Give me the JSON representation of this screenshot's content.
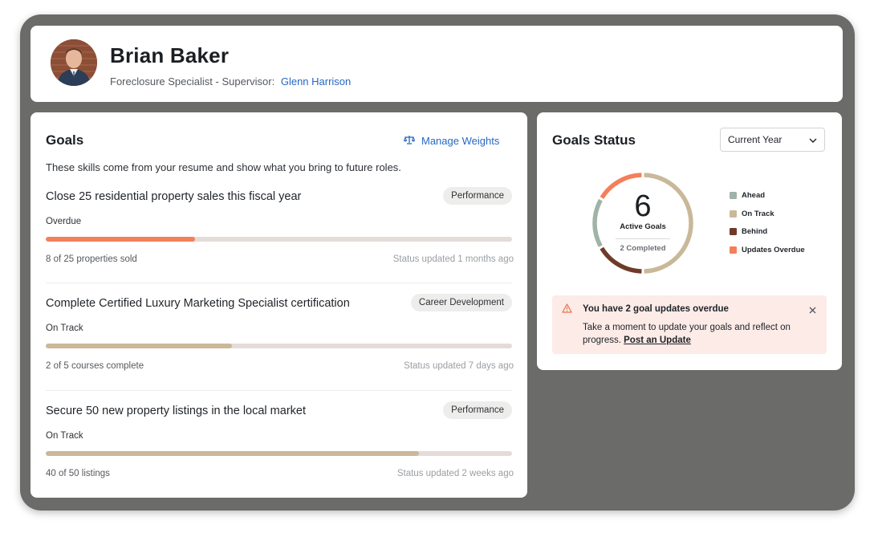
{
  "profile": {
    "name": "Brian Baker",
    "role": "Foreclosure Specialist",
    "supervisor_prefix": "- Supervisor:",
    "supervisor_name": "Glenn Harrison",
    "avatar_icon": "person-photo"
  },
  "goals": {
    "title": "Goals",
    "manage_label": "Manage Weights",
    "manage_icon": "scale-icon",
    "description": "These skills come from your resume and show what you bring to future roles.",
    "items": [
      {
        "title": "Close 25 residential property sales this fiscal year",
        "tag": "Performance",
        "status": "Overdue",
        "progress_text": "8 of 25 properties sold",
        "progress": 0.32,
        "bar_color": "#f47f5b",
        "updated": "Status updated 1 months ago"
      },
      {
        "title": "Complete Certified Luxury Marketing Specialist certification",
        "tag": "Career Development",
        "status": "On Track",
        "progress_text": "2 of 5 courses complete",
        "progress": 0.4,
        "bar_color": "#c9b899",
        "updated": "Status updated 7 days ago"
      },
      {
        "title": "Secure 50 new property listings in the local market",
        "tag": "Performance",
        "status": "On Track",
        "progress_text": "40 of 50 listings",
        "progress": 0.8,
        "bar_color": "#c9b899",
        "updated": "Status updated 2 weeks ago"
      }
    ]
  },
  "status": {
    "title": "Goals Status",
    "period": "Current Year",
    "active_count": "6",
    "active_label": "Active Goals",
    "completed_label": "2 Completed",
    "segments": [
      {
        "name": "On Track",
        "fraction": 0.5,
        "color": "#c9b899"
      },
      {
        "name": "Behind",
        "fraction": 0.167,
        "color": "#6e3b2a"
      },
      {
        "name": "Ahead",
        "fraction": 0.167,
        "color": "#9fb3a8"
      },
      {
        "name": "Updates Overdue",
        "fraction": 0.166,
        "color": "#f47f5b"
      }
    ],
    "legend": [
      {
        "label": "Ahead",
        "color": "#9fb3a8"
      },
      {
        "label": "On Track",
        "color": "#c9b899"
      },
      {
        "label": "Behind",
        "color": "#6e3b2a"
      },
      {
        "label": "Updates Overdue",
        "color": "#f47f5b"
      }
    ],
    "alert": {
      "icon": "warning-icon",
      "title": "You have 2 goal updates overdue",
      "body": "Take a moment to update your goals and reflect on progress.",
      "link": "Post an Update"
    }
  }
}
